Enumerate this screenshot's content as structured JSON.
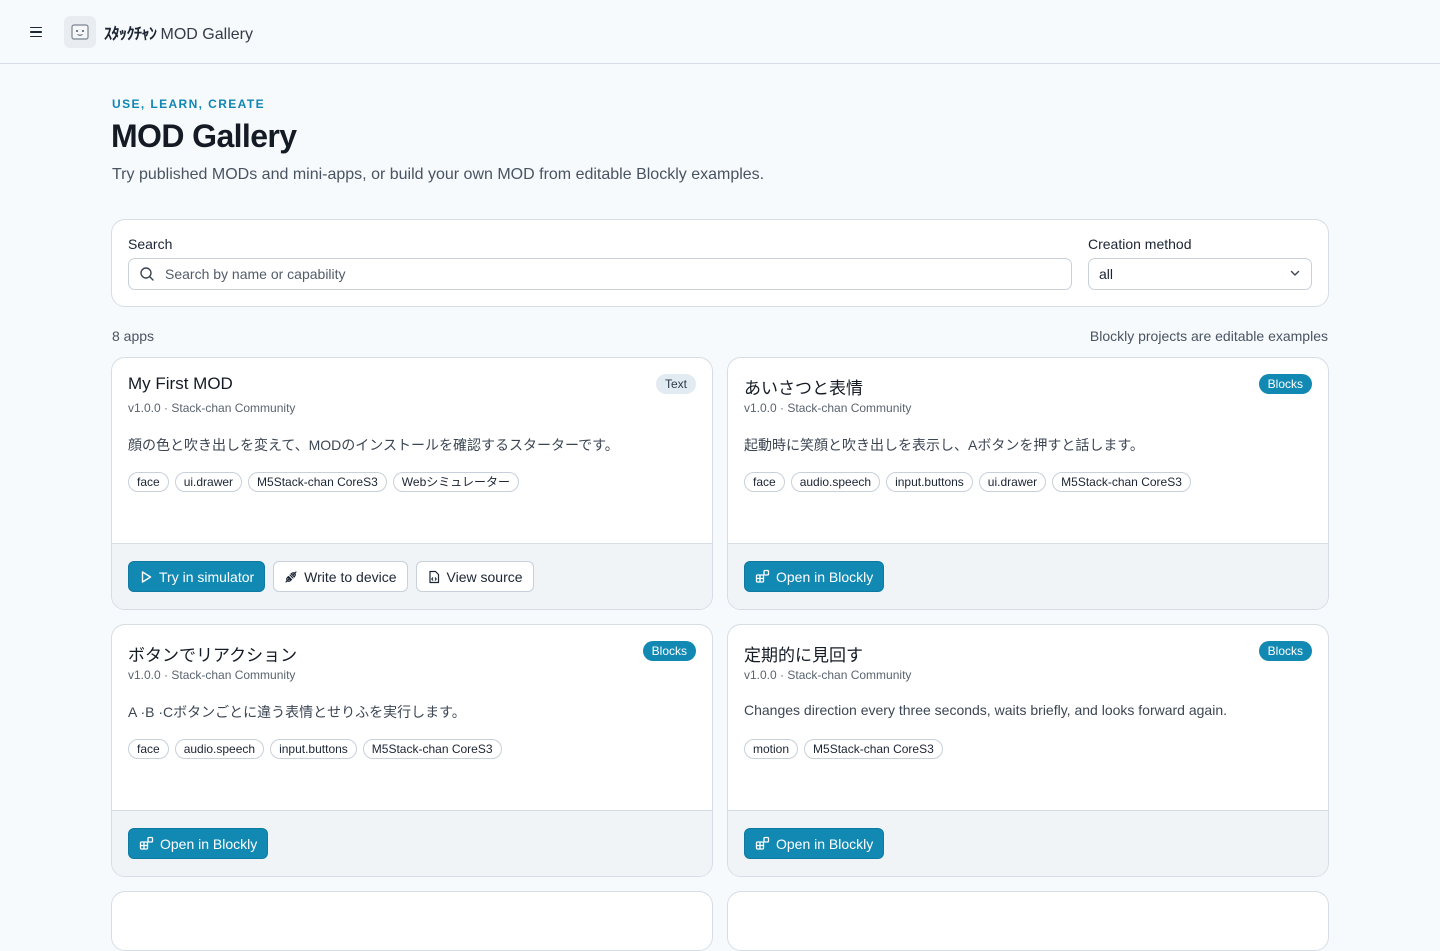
{
  "header": {
    "brand_jp": "ｽﾀｯｸﾁｬﾝ",
    "brand_rest": "MOD Gallery",
    "menu_icon": "hamburger-icon",
    "logo_icon": "app-logo-icon"
  },
  "hero": {
    "eyebrow": "USE, LEARN, CREATE",
    "title": "MOD Gallery",
    "subtitle": "Try published MODs and mini-apps, or build your own MOD from editable Blockly examples."
  },
  "filters": {
    "search_label": "Search",
    "search_placeholder": "Search by name or capability",
    "search_value": "",
    "method_label": "Creation method",
    "method_value": "all"
  },
  "summary": {
    "count": "8 apps",
    "hint": "Blockly projects are editable examples"
  },
  "colors": {
    "accent": "#1289b3",
    "eyebrow": "#0f86b3"
  },
  "cards": [
    {
      "title": "My First MOD",
      "badge": "Text",
      "meta": "v1.0.0 · Stack-chan Community",
      "description": "顔の色と吹き出しを変えて、MODのインストールを確認するスターターです。",
      "tags": [
        "face",
        "ui.drawer",
        "M5Stack-chan CoreS3",
        "Webシミュレーター"
      ],
      "actions": [
        "Try in simulator",
        "Write to device",
        "View source"
      ]
    },
    {
      "title": "あいさつと表情",
      "badge": "Blocks",
      "meta": "v1.0.0 · Stack-chan Community",
      "description": "起動時に笑顔と吹き出しを表示し、Aボタンを押すと話します。",
      "tags": [
        "face",
        "audio.speech",
        "input.buttons",
        "ui.drawer",
        "M5Stack-chan CoreS3"
      ],
      "actions": [
        "Open in Blockly"
      ]
    },
    {
      "title": "ボタンでリアクション",
      "badge": "Blocks",
      "meta": "v1.0.0 · Stack-chan Community",
      "description": "A ·B ·Cボタンごとに違う表情とせりふを実行します。",
      "tags": [
        "face",
        "audio.speech",
        "input.buttons",
        "M5Stack-chan CoreS3"
      ],
      "actions": [
        "Open in Blockly"
      ]
    },
    {
      "title": "定期的に見回す",
      "badge": "Blocks",
      "meta": "v1.0.0 · Stack-chan Community",
      "description": "Changes direction every three seconds, waits briefly, and looks forward again.",
      "tags": [
        "motion",
        "M5Stack-chan CoreS3"
      ],
      "actions": [
        "Open in Blockly"
      ]
    }
  ]
}
